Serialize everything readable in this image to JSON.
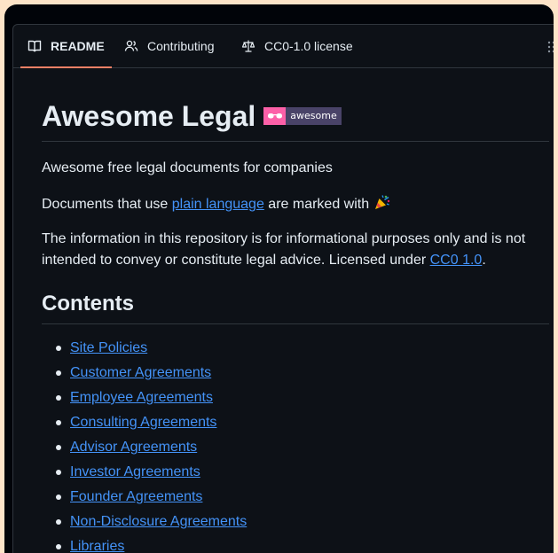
{
  "tabs": [
    {
      "label": "README",
      "icon": "book-icon",
      "active": true
    },
    {
      "label": "Contributing",
      "icon": "people-icon",
      "active": false
    },
    {
      "label": "CC0-1.0 license",
      "icon": "law-icon",
      "active": false
    }
  ],
  "readme": {
    "title": "Awesome Legal",
    "badge_label": "awesome",
    "intro": "Awesome free legal documents for companies",
    "plain_prefix": "Documents that use ",
    "plain_link": "plain language",
    "plain_suffix": " are marked with ",
    "plain_emoji": "🎉",
    "disclaimer": "The information in this repository is for informational purposes only and is not intended to convey or constitute legal advice. Licensed under ",
    "license_link": "CC0 1.0",
    "disclaimer_end": ".",
    "contents_heading": "Contents",
    "contents": [
      "Site Policies",
      "Customer Agreements",
      "Employee Agreements",
      "Consulting Agreements",
      "Advisor Agreements",
      "Investor Agreements",
      "Founder Agreements",
      "Non-Disclosure Agreements",
      "Libraries"
    ]
  },
  "colors": {
    "background": "#0d1117",
    "text": "#e6edf3",
    "link": "#4493f8",
    "tab_underline": "#f78166",
    "badge_pink": "#fc60a8",
    "badge_purple": "#494368"
  }
}
